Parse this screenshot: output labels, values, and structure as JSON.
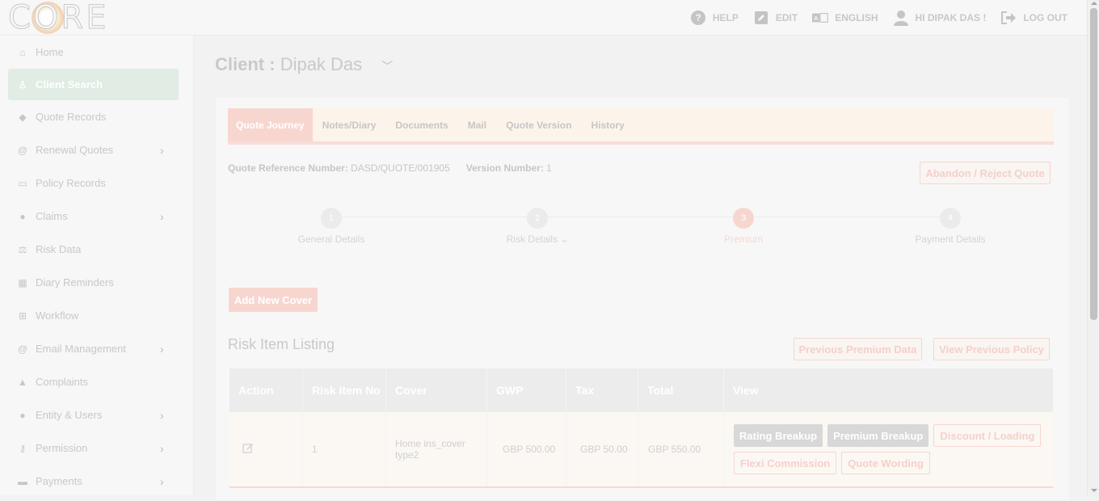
{
  "app": {
    "logo_text": "CORE"
  },
  "topnav": {
    "help": "HELP",
    "edit": "EDIT",
    "language": "ENGLISH",
    "user": "HI DIPAK DAS !",
    "logout": "LOG OUT"
  },
  "sidebar": {
    "items": [
      {
        "label": "Home",
        "icon": "home-icon",
        "glyph": "⌂"
      },
      {
        "label": "Client Search",
        "icon": "user-icon",
        "glyph": "♙"
      },
      {
        "label": "Quote Records",
        "icon": "tag-icon",
        "glyph": "◆"
      },
      {
        "label": "Renewal Quotes",
        "icon": "at-icon",
        "glyph": "@"
      },
      {
        "label": "Policy Records",
        "icon": "folder-icon",
        "glyph": "▭"
      },
      {
        "label": "Claims",
        "icon": "person-icon",
        "glyph": "●"
      },
      {
        "label": "Risk Data",
        "icon": "scale-icon",
        "glyph": "⚖"
      },
      {
        "label": "Diary Reminders",
        "icon": "calendar-icon",
        "glyph": "▦"
      },
      {
        "label": "Workflow",
        "icon": "sitemap-icon",
        "glyph": "⊞"
      },
      {
        "label": "Email Management",
        "icon": "at-icon",
        "glyph": "@"
      },
      {
        "label": "Complaints",
        "icon": "warning-icon",
        "glyph": "▲"
      },
      {
        "label": "Entity & Users",
        "icon": "person-icon",
        "glyph": "●"
      },
      {
        "label": "Permission",
        "icon": "key-icon",
        "glyph": "⚷"
      },
      {
        "label": "Payments",
        "icon": "credit-card-icon",
        "glyph": "▬"
      }
    ]
  },
  "client": {
    "prefix": "Client :",
    "name": "Dipak Das"
  },
  "tabs": [
    "Quote Journey",
    "Notes/Diary",
    "Documents",
    "Mail",
    "Quote Version",
    "History"
  ],
  "quote": {
    "ref_label": "Quote Reference Number:",
    "ref_value": "DASD/QUOTE/001905",
    "version_label": "Version Number:",
    "version_value": "1",
    "abandon": "Abandon / Reject Quote"
  },
  "steps": [
    {
      "num": "1",
      "label": "General Details"
    },
    {
      "num": "2",
      "label": "Risk Details"
    },
    {
      "num": "3",
      "label": "Premium"
    },
    {
      "num": "4",
      "label": "Payment Details"
    }
  ],
  "actions": {
    "add_cover": "Add New Cover",
    "previous_premium": "Previous Premium Data",
    "view_previous": "View Previous Policy"
  },
  "risk_listing": {
    "title": "Risk Item Listing",
    "columns": [
      "Action",
      "Risk Item No",
      "Cover",
      "GWP",
      "Tax",
      "Total",
      "View"
    ],
    "rows": [
      {
        "risk_no": "1",
        "cover": "Home ins_cover type2",
        "gwp": "GBP  500.00",
        "tax": "GBP  50.00",
        "total": "GBP   550.00",
        "view_buttons": [
          "Rating Breakup",
          "Premium Breakup",
          "Discount / Loading",
          "Flexi Commission",
          "Quote Wording"
        ]
      }
    ]
  }
}
